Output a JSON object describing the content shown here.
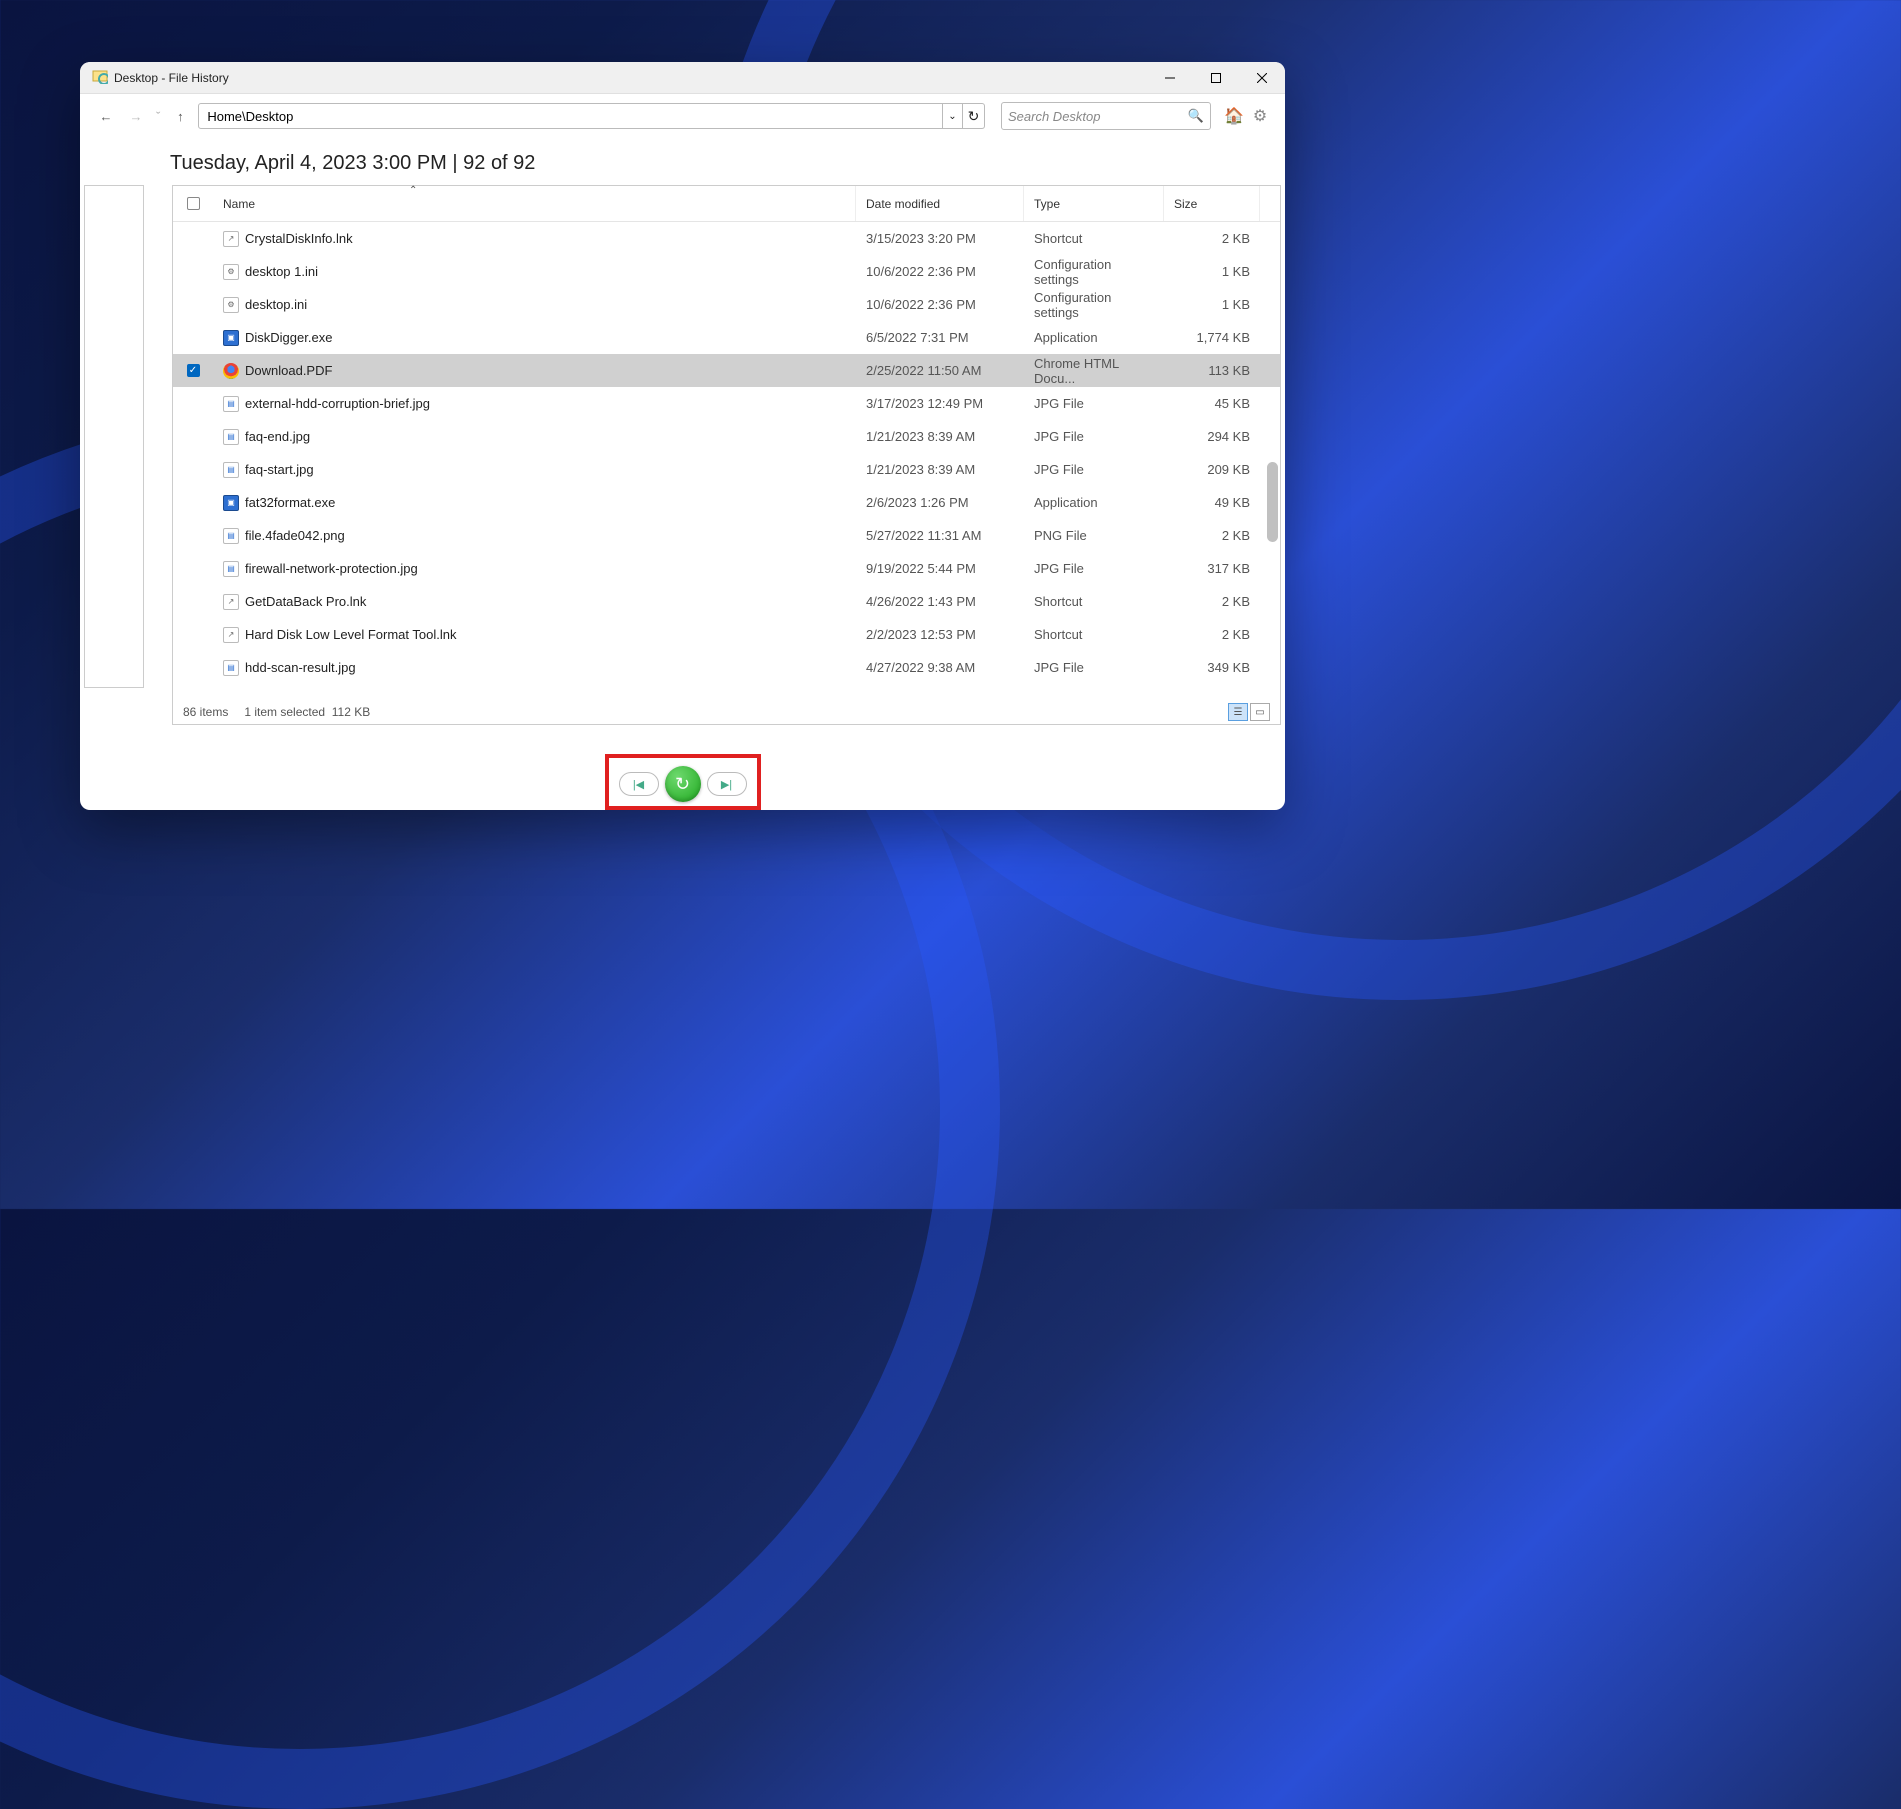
{
  "window": {
    "title": "Desktop - File History",
    "path": "Home\\Desktop",
    "search_placeholder": "Search Desktop",
    "dateline": "Tuesday, April 4, 2023 3:00 PM   |   92 of 92"
  },
  "columns": {
    "name": "Name",
    "date": "Date modified",
    "type": "Type",
    "size": "Size"
  },
  "files": [
    {
      "name": "CrystalDiskInfo.lnk",
      "date": "3/15/2023 3:20 PM",
      "type": "Shortcut",
      "size": "2 KB",
      "icon": "lnk",
      "selected": false
    },
    {
      "name": "desktop 1.ini",
      "date": "10/6/2022 2:36 PM",
      "type": "Configuration settings",
      "size": "1 KB",
      "icon": "ini",
      "selected": false
    },
    {
      "name": "desktop.ini",
      "date": "10/6/2022 2:36 PM",
      "type": "Configuration settings",
      "size": "1 KB",
      "icon": "ini",
      "selected": false
    },
    {
      "name": "DiskDigger.exe",
      "date": "6/5/2022 7:31 PM",
      "type": "Application",
      "size": "1,774 KB",
      "icon": "exe",
      "selected": false
    },
    {
      "name": "Download.PDF",
      "date": "2/25/2022 11:50 AM",
      "type": "Chrome HTML Docu...",
      "size": "113 KB",
      "icon": "chrome",
      "selected": true
    },
    {
      "name": "external-hdd-corruption-brief.jpg",
      "date": "3/17/2023 12:49 PM",
      "type": "JPG File",
      "size": "45 KB",
      "icon": "jpg",
      "selected": false
    },
    {
      "name": "faq-end.jpg",
      "date": "1/21/2023 8:39 AM",
      "type": "JPG File",
      "size": "294 KB",
      "icon": "jpg",
      "selected": false
    },
    {
      "name": "faq-start.jpg",
      "date": "1/21/2023 8:39 AM",
      "type": "JPG File",
      "size": "209 KB",
      "icon": "jpg",
      "selected": false
    },
    {
      "name": "fat32format.exe",
      "date": "2/6/2023 1:26 PM",
      "type": "Application",
      "size": "49 KB",
      "icon": "exe",
      "selected": false
    },
    {
      "name": "file.4fade042.png",
      "date": "5/27/2022 11:31 AM",
      "type": "PNG File",
      "size": "2 KB",
      "icon": "png",
      "selected": false
    },
    {
      "name": "firewall-network-protection.jpg",
      "date": "9/19/2022 5:44 PM",
      "type": "JPG File",
      "size": "317 KB",
      "icon": "jpg",
      "selected": false
    },
    {
      "name": "GetDataBack Pro.lnk",
      "date": "4/26/2022 1:43 PM",
      "type": "Shortcut",
      "size": "2 KB",
      "icon": "lnk",
      "selected": false
    },
    {
      "name": "Hard Disk Low Level Format Tool.lnk",
      "date": "2/2/2023 12:53 PM",
      "type": "Shortcut",
      "size": "2 KB",
      "icon": "lnk",
      "selected": false
    },
    {
      "name": "hdd-scan-result.jpg",
      "date": "4/27/2022 9:38 AM",
      "type": "JPG File",
      "size": "349 KB",
      "icon": "jpg",
      "selected": false
    }
  ],
  "status": {
    "items": "86 items",
    "selected": "1 item selected",
    "selsize": "112 KB"
  }
}
